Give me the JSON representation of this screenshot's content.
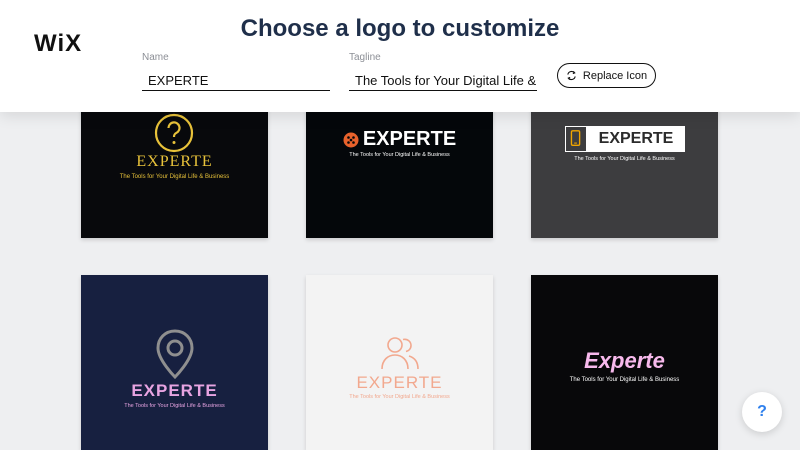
{
  "header": {
    "brand": "WiX",
    "title": "Choose a logo to customize",
    "name_label": "Name",
    "name_value": "EXPERTE",
    "tagline_label": "Tagline",
    "tagline_value": "The Tools for Your Digital Life & B",
    "replace_icon_label": "Replace Icon"
  },
  "logos": [
    {
      "name": "EXPERTE",
      "tagline": "The Tools for Your Digital Life & Business",
      "icon": "question-circle-icon",
      "background": "#08090c",
      "accent": "#e8c23a"
    },
    {
      "name": "EXPERTE",
      "tagline": "The Tools for Your Digital Life & Business",
      "icon": "orange-dots-icon",
      "background": "#04070a",
      "accent": "#ffffff"
    },
    {
      "name": "EXPERTE",
      "tagline": "The Tools for Your Digital Life & Business",
      "icon": "phone-icon",
      "background": "#3d3d3f",
      "accent": "#ffffff"
    },
    {
      "name": "EXPERTE",
      "tagline": "The Tools for Your Digital Life & Business",
      "icon": "location-pin-icon",
      "background": "#172040",
      "accent": "#e8a4e2"
    },
    {
      "name": "EXPERTE",
      "tagline": "The Tools for Your Digital Life & Business",
      "icon": "people-icon",
      "background": "#f3f3f3",
      "accent": "#f2a88e"
    },
    {
      "name": "Experte",
      "tagline": "The Tools for Your Digital Life & Business",
      "icon": "",
      "background": "#08080a",
      "accent": "#f7b9ec"
    }
  ],
  "help": {
    "label": "?"
  }
}
